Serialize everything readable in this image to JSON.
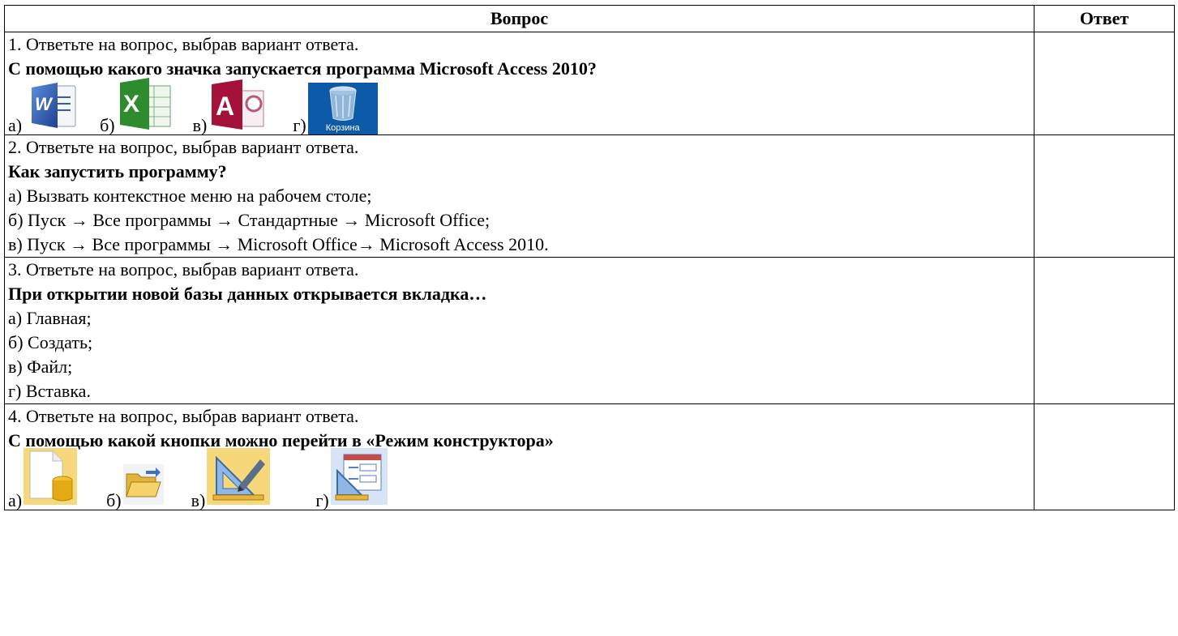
{
  "header": {
    "question": "Вопрос",
    "answer": "Ответ"
  },
  "q1": {
    "instruction": "1. Ответьте на вопрос, выбрав вариант ответа.",
    "question": "С помощью какого значка запускается программа Microsoft Access 2010?",
    "options": [
      {
        "letter": "а)",
        "icon": "word-icon"
      },
      {
        "letter": "б)",
        "icon": "excel-icon"
      },
      {
        "letter": "в)",
        "icon": "access-icon"
      },
      {
        "letter": "г)",
        "icon": "recycle-bin-icon",
        "caption": "Корзина"
      }
    ]
  },
  "q2": {
    "instruction": "2. Ответьте на вопрос, выбрав вариант ответа.",
    "question": "Как запустить программу?",
    "options": [
      "а) Вызвать контекстное меню на рабочем столе;",
      "б) Пуск → Все программы → Стандартные → Microsoft Office;",
      "в) Пуск → Все программы → Microsoft Office→ Microsoft Access 2010."
    ]
  },
  "q3": {
    "instruction": "3. Ответьте на вопрос, выбрав вариант ответа.",
    "question": "При открытии новой базы данных открывается вкладка…",
    "options": [
      "а) Главная;",
      "б) Создать;",
      "в) Файл;",
      "г) Вставка."
    ]
  },
  "q4": {
    "instruction": "4. Ответьте на вопрос, выбрав вариант ответа.",
    "question": "С помощью какой кнопки можно перейти в «Режим конструктора»",
    "options": [
      {
        "letter": "а)",
        "icon": "new-database-icon"
      },
      {
        "letter": "б)",
        "icon": "open-folder-icon"
      },
      {
        "letter": "в)",
        "icon": "design-view-icon"
      },
      {
        "letter": "г)",
        "icon": "form-design-icon"
      }
    ]
  }
}
